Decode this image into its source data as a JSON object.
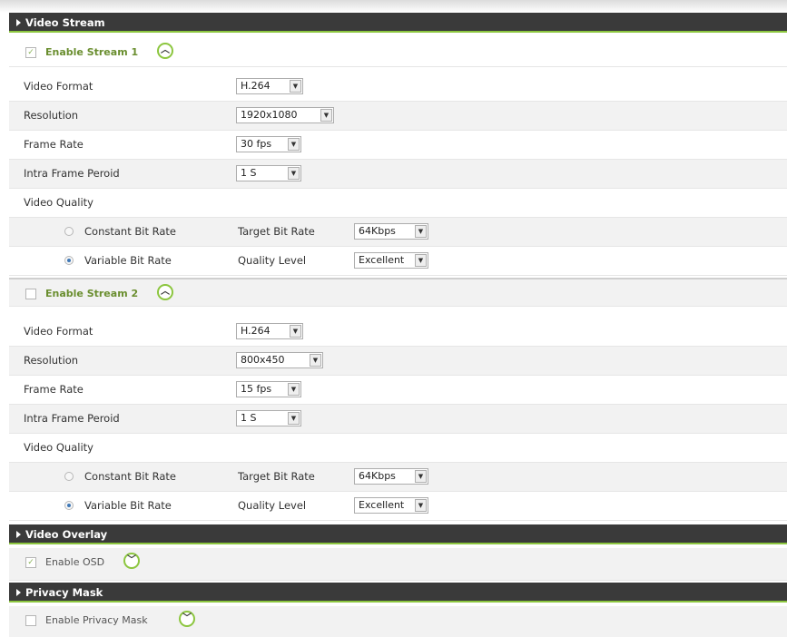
{
  "sections": {
    "video_stream": "Video Stream",
    "video_overlay": "Video Overlay",
    "privacy_mask": "Privacy Mask"
  },
  "stream1": {
    "enable_label": "Enable Stream 1",
    "enabled": true,
    "video_format_label": "Video Format",
    "video_format": "H.264",
    "resolution_label": "Resolution",
    "resolution": "1920x1080",
    "frame_rate_label": "Frame Rate",
    "frame_rate": "30 fps",
    "intra_label": "Intra Frame Peroid",
    "intra": "1 S",
    "quality_label": "Video Quality",
    "cbr_label": "Constant Bit Rate",
    "target_bit_rate_label": "Target Bit Rate",
    "target_bit_rate": "64Kbps",
    "vbr_label": "Variable Bit Rate",
    "quality_level_label": "Quality Level",
    "quality_level": "Excellent"
  },
  "stream2": {
    "enable_label": "Enable Stream 2",
    "enabled": false,
    "video_format_label": "Video Format",
    "video_format": "H.264",
    "resolution_label": "Resolution",
    "resolution": "800x450",
    "frame_rate_label": "Frame Rate",
    "frame_rate": "15 fps",
    "intra_label": "Intra Frame Peroid",
    "intra": "1 S",
    "quality_label": "Video Quality",
    "cbr_label": "Constant Bit Rate",
    "target_bit_rate_label": "Target Bit Rate",
    "target_bit_rate": "64Kbps",
    "vbr_label": "Variable Bit Rate",
    "quality_level_label": "Quality Level",
    "quality_level": "Excellent"
  },
  "overlay": {
    "enable_label": "Enable OSD",
    "enabled": true
  },
  "privacy": {
    "enable_label": "Enable Privacy Mask",
    "enabled": false
  },
  "icons": {
    "expand_up": "chevron-up-icon",
    "expand_down": "chevron-down-icon",
    "select_arrow": "dropdown-arrow-icon"
  },
  "colors": {
    "accent": "#8cc63f",
    "header_bg": "#3a3a3a",
    "enable_text": "#6a8e2f"
  }
}
